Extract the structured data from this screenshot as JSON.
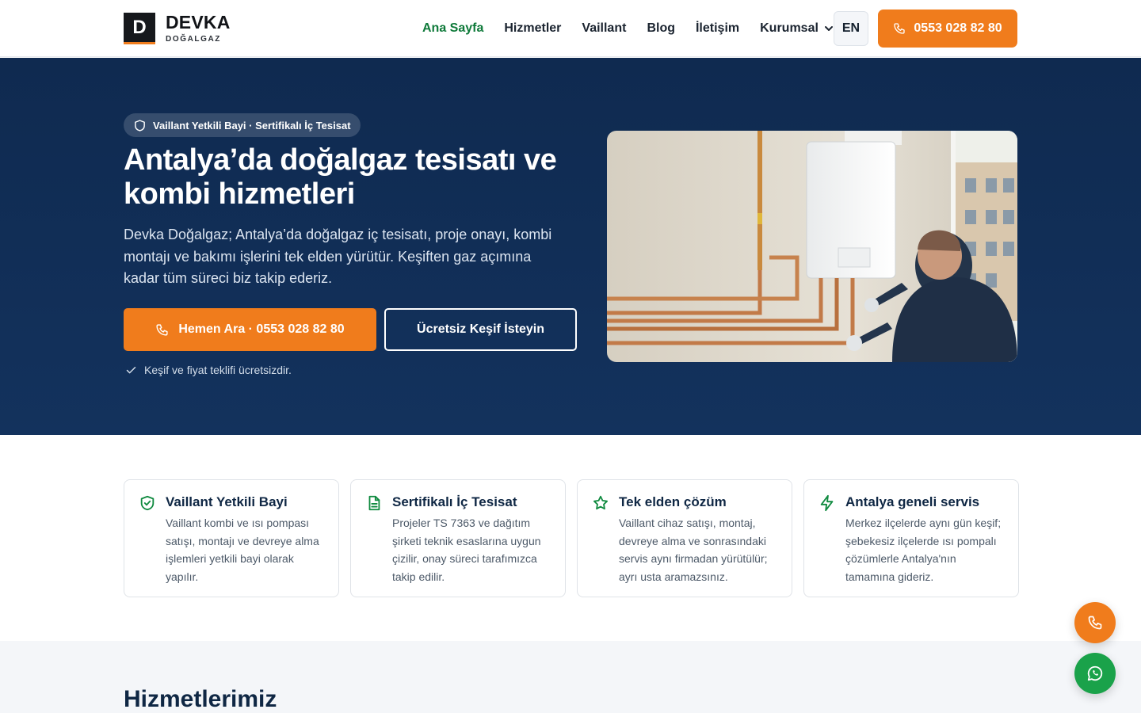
{
  "header": {
    "logo_letter": "D",
    "logo_name": "DEVKA",
    "logo_sub": "DOĞALGAZ",
    "nav": [
      {
        "label": "Ana Sayfa",
        "active": true
      },
      {
        "label": "Hizmetler"
      },
      {
        "label": "Vaillant"
      },
      {
        "label": "Blog"
      },
      {
        "label": "İletişim"
      },
      {
        "label": "Kurumsal",
        "dropdown": true
      }
    ],
    "lang_label": "EN",
    "phone_label": "0553 028 82 80"
  },
  "hero": {
    "badge": "Vaillant Yetkili Bayi · Sertifikalı İç Tesisat",
    "title": "Antalya’da doğalgaz tesisatı ve kombi hizmetleri",
    "description": "Devka Doğalgaz; Antalya’da doğalgaz iç tesisatı, proje onayı, kombi montajı ve bakımı işlerini tek elden yürütür. Keşiften gaz açımına kadar tüm süreci biz takip ederiz.",
    "primary_button": "Hemen Ara · 0553 028 82 80",
    "secondary_button": "Ücretsiz Keşif İsteyin",
    "note": "Keşif ve fiyat teklifi ücretsizdir."
  },
  "features": [
    {
      "icon": "shield-icon",
      "title": "Vaillant Yetkili Bayi",
      "text": "Vaillant kombi ve ısı pompası satışı, montajı ve devreye alma işlemleri yetkili bayi olarak yapılır."
    },
    {
      "icon": "document-icon",
      "title": "Sertifikalı İç Tesisat",
      "text": "Projeler TS 7363 ve dağıtım şirketi teknik esaslarına uygun çizilir, onay süreci tarafımızca takip edilir."
    },
    {
      "icon": "star-icon",
      "title": "Tek elden çözüm",
      "text": "Vaillant cihaz satışı, montaj, devreye alma ve sonrasındaki servis aynı firmadan yürütülür; ayrı usta aramazsınız."
    },
    {
      "icon": "lightning-icon",
      "title": "Antalya geneli servis",
      "text": "Merkez ilçelerde aynı gün keşif; şebekesiz ilçelerde ısı pompalı çözümlerle Antalya'nın tamamına gideriz."
    }
  ],
  "services": {
    "title": "Hizmetlerimiz"
  },
  "colors": {
    "accent": "#f07c1c",
    "navy": "#0f2a50",
    "green": "#0f7a3a",
    "whatsapp": "#1aa24a"
  }
}
